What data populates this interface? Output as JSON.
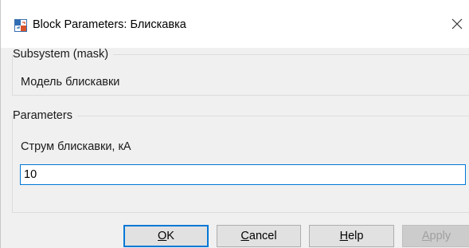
{
  "window": {
    "title": "Block Parameters: Блискавка",
    "app_icon": "simulink-block-icon",
    "close_glyph": "✕"
  },
  "subsystem": {
    "legend": "Subsystem (mask)",
    "description": "Модель блискавки"
  },
  "parameters": {
    "legend": "Parameters",
    "field_label": "Струм блискавки, кА",
    "field_value": "10"
  },
  "buttons": {
    "ok": {
      "mnemonic": "O",
      "rest": "K"
    },
    "cancel": {
      "mnemonic": "C",
      "rest": "ancel"
    },
    "help": {
      "mnemonic": "H",
      "rest": "elp"
    },
    "apply": {
      "mnemonic": "A",
      "rest": "pply",
      "enabled": false
    }
  },
  "colors": {
    "focus_accent": "#0078d7",
    "dialog_bg": "#f0f0f0",
    "disabled_text": "#a0a0a0"
  }
}
